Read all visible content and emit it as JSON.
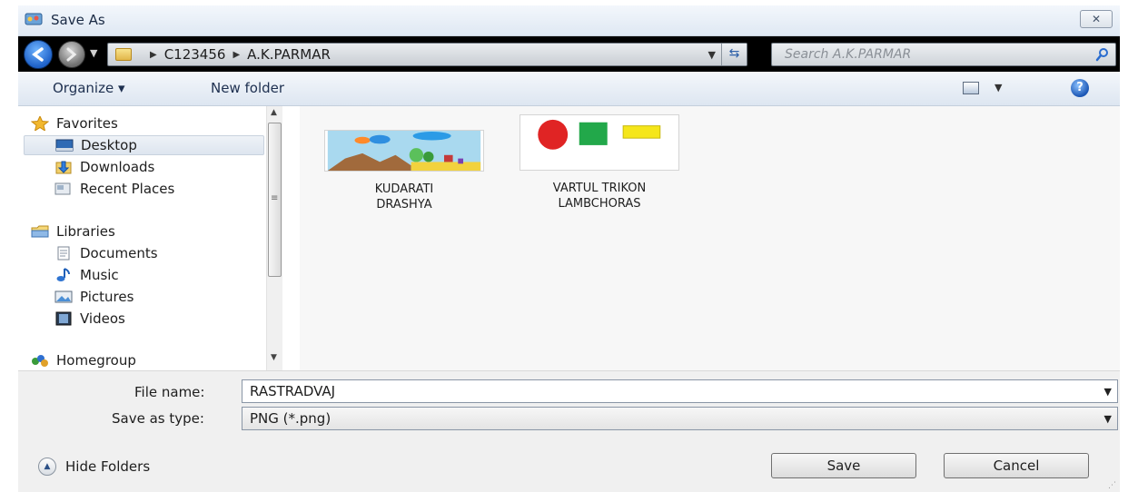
{
  "window": {
    "title": "Save As",
    "close_label": "✕"
  },
  "address": {
    "crumbs": [
      "C123456",
      "A.K.PARMAR"
    ],
    "search_placeholder": "Search A.K.PARMAR"
  },
  "toolbar": {
    "organize": "Organize ▾",
    "new_folder": "New folder"
  },
  "nav": {
    "favorites": "Favorites",
    "desktop": "Desktop",
    "downloads": "Downloads",
    "recent_places": "Recent Places",
    "libraries": "Libraries",
    "documents": "Documents",
    "music": "Music",
    "pictures": "Pictures",
    "videos": "Videos",
    "homegroup": "Homegroup"
  },
  "files": [
    {
      "name_line1": "KUDARATI",
      "name_line2": "DRASHYA"
    },
    {
      "name_line1": "VARTUL TRIKON",
      "name_line2": "LAMBCHORAS"
    }
  ],
  "form": {
    "file_name_label": "File name:",
    "file_name_value": "RASTRADVAJ",
    "save_type_label": "Save as type:",
    "save_type_value": "PNG (*.png)"
  },
  "footer": {
    "hide_folders": "Hide Folders",
    "save": "Save",
    "cancel": "Cancel"
  }
}
